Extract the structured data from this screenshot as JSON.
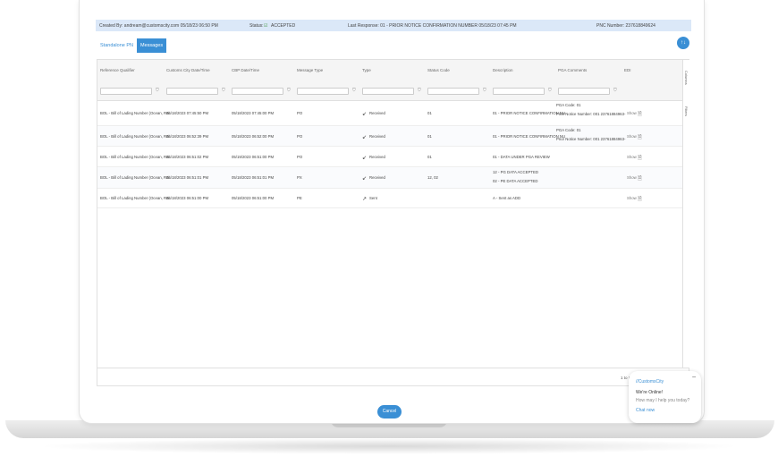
{
  "header": {
    "created_by": "Created By: andream@customscity.com 05/18/23 06:50 PM",
    "status_label": "Status:",
    "status": "ACCEPTED",
    "last_response": "Last Response: 01 - PRIOR NOTICE CONFIRMATION NUMBER 05/18/23 07:45 PM",
    "pnc": "PNC Number: 237618849624"
  },
  "tabs": [
    {
      "label": "Standalone PN"
    },
    {
      "label": "Messages"
    }
  ],
  "fab_label": "↑↓",
  "columns": [
    "Reference Qualifier",
    "Customs City Date/Time",
    "CBP Date/Time",
    "Message Type",
    "Type",
    "Status Code",
    "Description",
    "PGA Comments",
    "EDI"
  ],
  "rows": [
    {
      "ref": "BOL - Bill of Lading Number (Ocean, Rai",
      "cc": "05/18/2023 07:45:50 PM",
      "cbp": "05/18/2023 07:45:00 PM",
      "msg": "PO",
      "type": "Received",
      "icon": "arrow-in",
      "status": "01",
      "desc": [
        "01 - PRIOR NOTICE CONFIRMATION NU"
      ],
      "pga": [
        "PGA Code: 01",
        "Prior Notice Number: 001 23761884963-"
      ],
      "edi": "Show"
    },
    {
      "ref": "BOL - Bill of Lading Number (Ocean, Rai",
      "cc": "05/18/2023 06:52:39 PM",
      "cbp": "05/18/2023 06:52:00 PM",
      "msg": "PO",
      "type": "Received",
      "icon": "arrow-in",
      "status": "01",
      "desc": [
        "01 - PRIOR NOTICE CONFIRMATION NU"
      ],
      "pga": [
        "PGA Code: 01",
        "Prior Notice Number: 001 23761884963-"
      ],
      "edi": "Show"
    },
    {
      "ref": "BOL - Bill of Lading Number (Ocean, Rai",
      "cc": "05/18/2023 06:51:02 PM",
      "cbp": "05/19/2023 06:51:00 PM",
      "msg": "PO",
      "type": "Received",
      "icon": "arrow-in",
      "status": "01",
      "desc": [
        "01 - DATA UNDER PGA REVIEW"
      ],
      "pga": [],
      "edi": "Show"
    },
    {
      "ref": "BOL - Bill of Lading Number (Ocean, Rai",
      "cc": "05/18/2023 06:51:01 PM",
      "cbp": "05/18/2023 06:51:01 PM",
      "msg": "PX",
      "type": "Received",
      "icon": "arrow-in",
      "status": "12, 02",
      "desc": [
        "12 - PG DATA ACCEPTED",
        "02 - PE DATA ACCEPTED"
      ],
      "pga": [],
      "edi": "Show"
    },
    {
      "ref": "BOL - Bill of Lading Number (Ocean, Rai",
      "cc": "05/18/2023 06:51:00 PM",
      "cbp": "05/18/2023 06:51:00 PM",
      "msg": "PE",
      "type": "Sent",
      "icon": "arrow-out",
      "status": "",
      "desc": [
        "A - Sent as ADD"
      ],
      "pga": [],
      "edi": "Show"
    }
  ],
  "side": {
    "columns": "Columns",
    "filters": "Filters"
  },
  "footer": {
    "pagination": "1 to 5"
  },
  "cancel": "Cancel",
  "chat": {
    "brand": "//CustomsCity",
    "title": "We're Online!",
    "subtitle": "How may I help you today?",
    "cta": "Chat now",
    "minimize": "–"
  },
  "colors": {
    "accent": "#3a8fd5",
    "header_bg": "#dbe8f8"
  }
}
